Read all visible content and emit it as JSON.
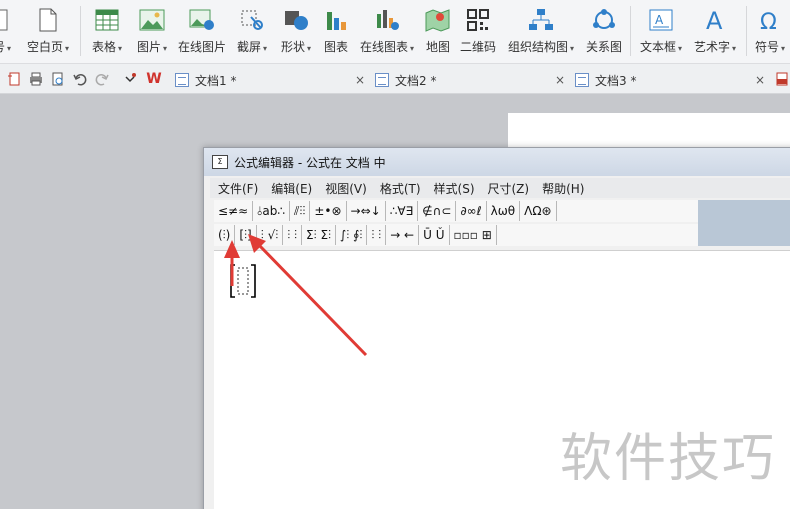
{
  "ribbon": {
    "items": [
      {
        "label": "号",
        "icon": "page-number-icon",
        "dropdown": true
      },
      {
        "label": "空白页",
        "icon": "blank-page-icon",
        "dropdown": true
      },
      {
        "label": "表格",
        "icon": "table-icon",
        "dropdown": true
      },
      {
        "label": "图片",
        "icon": "picture-icon",
        "dropdown": true
      },
      {
        "label": "在线图片",
        "icon": "online-picture-icon",
        "dropdown": false
      },
      {
        "label": "截屏",
        "icon": "screenshot-icon",
        "dropdown": true
      },
      {
        "label": "形状",
        "icon": "shapes-icon",
        "dropdown": true
      },
      {
        "label": "图表",
        "icon": "chart-icon",
        "dropdown": false
      },
      {
        "label": "在线图表",
        "icon": "online-chart-icon",
        "dropdown": true
      },
      {
        "label": "地图",
        "icon": "map-icon",
        "dropdown": false
      },
      {
        "label": "二维码",
        "icon": "qrcode-icon",
        "dropdown": false
      },
      {
        "label": "组织结构图",
        "icon": "org-chart-icon",
        "dropdown": true
      },
      {
        "label": "关系图",
        "icon": "relation-graph-icon",
        "dropdown": false
      },
      {
        "label": "文本框",
        "icon": "textbox-icon",
        "dropdown": true
      },
      {
        "label": "艺术字",
        "icon": "wordart-icon",
        "dropdown": true
      },
      {
        "label": "符号",
        "icon": "symbol-icon",
        "dropdown": true
      }
    ]
  },
  "tabs": {
    "doc1": "文档1 *",
    "doc2": "文档2 *",
    "doc3": "文档3 *",
    "close": "×",
    "wps_logo": "W"
  },
  "equation_editor": {
    "title": "公式编辑器 - 公式在 文档 中",
    "menu": [
      "文件(F)",
      "编辑(E)",
      "视图(V)",
      "格式(T)",
      "样式(S)",
      "尺寸(Z)",
      "帮助(H)"
    ],
    "toolbar_row1": [
      "≤≠≈",
      "⫰ab∴",
      "⫽⫶⫶",
      "±•⊗",
      "→⇔↓",
      "∴∀∃",
      "∉∩⊂",
      "∂∞ℓ",
      "λωθ",
      "ΛΩ⊛"
    ],
    "toolbar_row2": [
      "(⫶)",
      "[⫶]",
      "⫶ √⫶",
      "⫶ ⫶",
      "Σ⫶ Σ⫶",
      "∫⫶ ∮⫶",
      "⫶ ⫶",
      "→ ←",
      "Ū Ǔ",
      "▫▫▫ ⊞"
    ]
  },
  "watermark": "软件技巧",
  "colors": {
    "ribbon_bg": "#f4f5f7",
    "workspace_bg": "#c6c8cc",
    "arrow_red": "#e03b35",
    "titlebar": "#d3dbe7"
  }
}
